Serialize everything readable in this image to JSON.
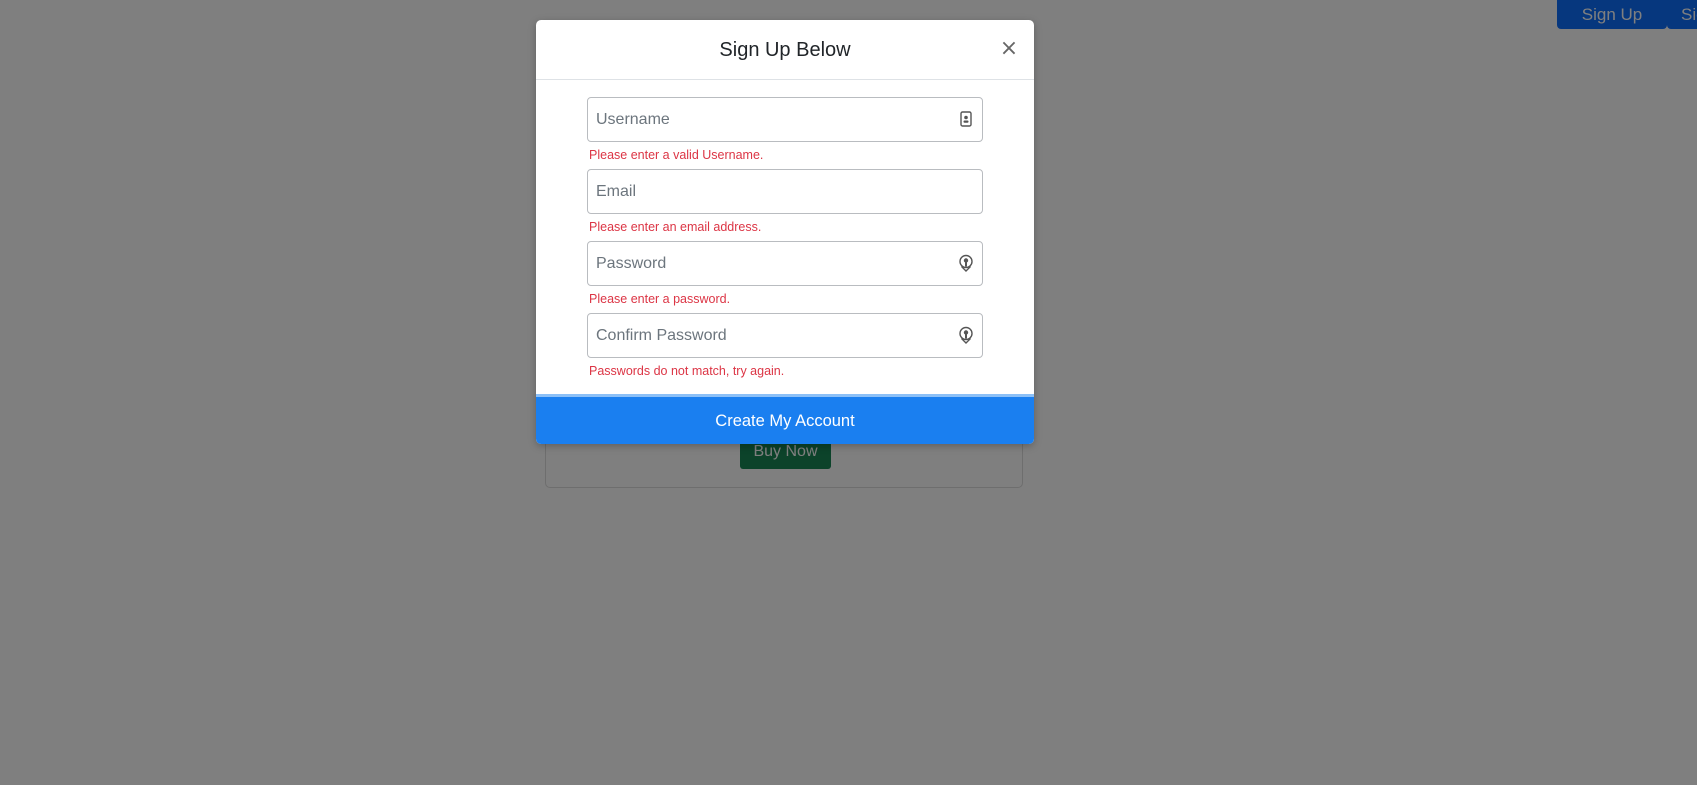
{
  "nav": {
    "signup_label": "Sign Up",
    "signin_label": "Sign In"
  },
  "product": {
    "buy_label": "Buy Now"
  },
  "modal": {
    "title": "Sign Up Below",
    "close_label": "×",
    "fields": {
      "username": {
        "placeholder": "Username",
        "value": "",
        "error": "Please enter a valid Username.",
        "icon": "id-card-icon"
      },
      "email": {
        "placeholder": "Email",
        "value": "",
        "error": "Please enter an email address."
      },
      "password": {
        "placeholder": "Password",
        "value": "",
        "error": "Please enter a password.",
        "icon": "key-icon"
      },
      "confirm_password": {
        "placeholder": "Confirm Password",
        "value": "",
        "error": "Passwords do not match, try again.",
        "icon": "key-icon"
      }
    },
    "submit_label": "Create My Account"
  },
  "colors": {
    "primary": "#0d6efd",
    "success": "#198754",
    "error": "#dc3545",
    "submit": "#1a7ff0"
  }
}
